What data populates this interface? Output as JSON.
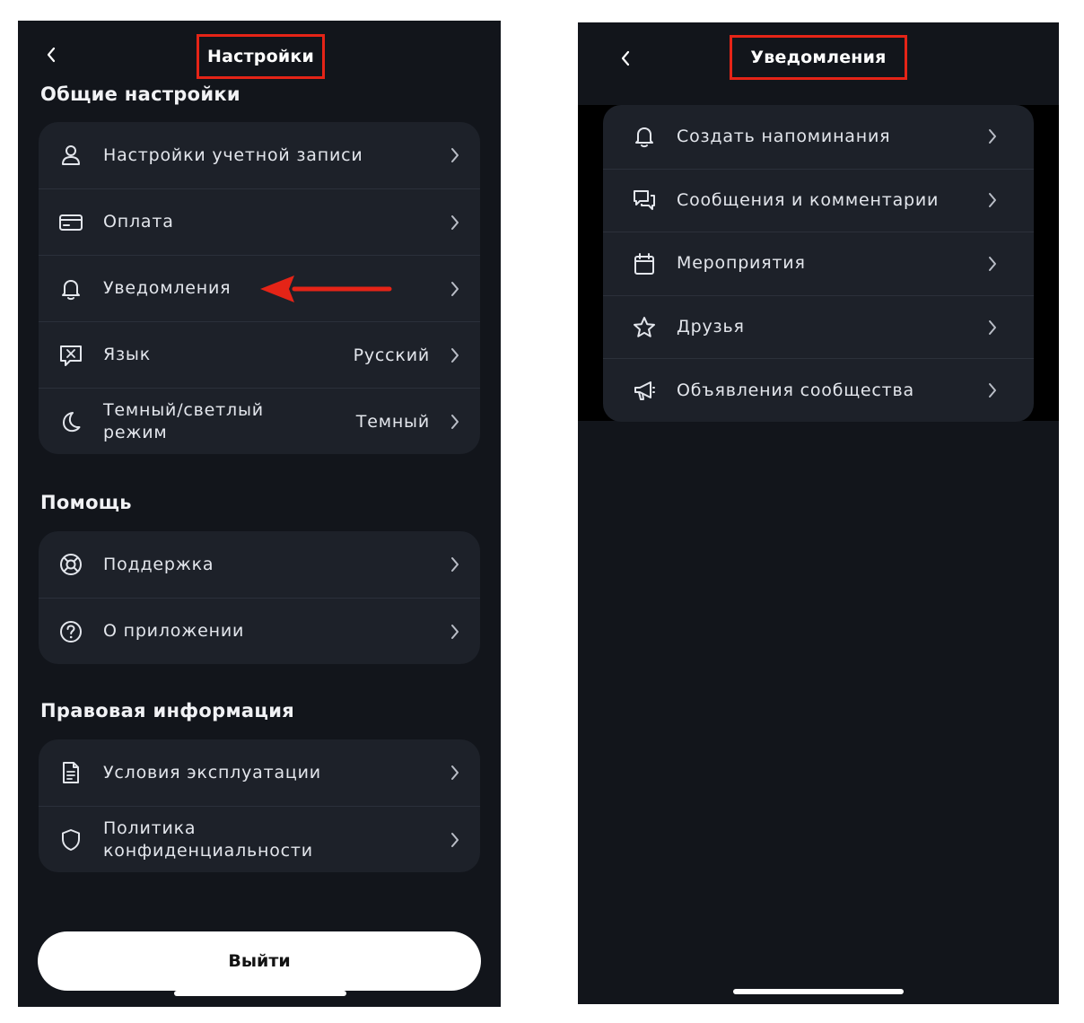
{
  "colors": {
    "background": "#12151b",
    "card": "#1d2129",
    "highlight": "#e52417",
    "text": "#e3e6ec"
  },
  "settings_screen": {
    "back_icon": "chevron-left-icon",
    "title": "Настройки",
    "general": {
      "title": "Общие настройки",
      "items": [
        {
          "icon": "user-icon",
          "label": "Настройки учетной записи",
          "value": ""
        },
        {
          "icon": "credit-card-icon",
          "label": "Оплата",
          "value": ""
        },
        {
          "icon": "bell-icon",
          "label": "Уведомления",
          "value": ""
        },
        {
          "icon": "language-icon",
          "label": "Язык",
          "value": "Русский"
        },
        {
          "icon": "moon-icon",
          "label": "Темный/светлый режим",
          "value": "Темный"
        }
      ]
    },
    "help": {
      "title": "Помощь",
      "items": [
        {
          "icon": "lifebuoy-icon",
          "label": "Поддержка"
        },
        {
          "icon": "question-circle-icon",
          "label": "О приложении"
        }
      ]
    },
    "legal": {
      "title": "Правовая информация",
      "items": [
        {
          "icon": "document-icon",
          "label": "Условия эксплуатации"
        },
        {
          "icon": "shield-icon",
          "label": "Политика конфиденциальности"
        }
      ]
    },
    "logout_label": "Выйти"
  },
  "notifications_screen": {
    "back_icon": "chevron-left-icon",
    "title": "Уведомления",
    "items": [
      {
        "icon": "bell-icon",
        "label": "Создать напоминания"
      },
      {
        "icon": "chat-bubbles-icon",
        "label": "Сообщения и комментарии"
      },
      {
        "icon": "calendar-icon",
        "label": "Мероприятия"
      },
      {
        "icon": "star-icon",
        "label": "Друзья"
      },
      {
        "icon": "megaphone-icon",
        "label": "Объявления сообщества"
      }
    ]
  }
}
